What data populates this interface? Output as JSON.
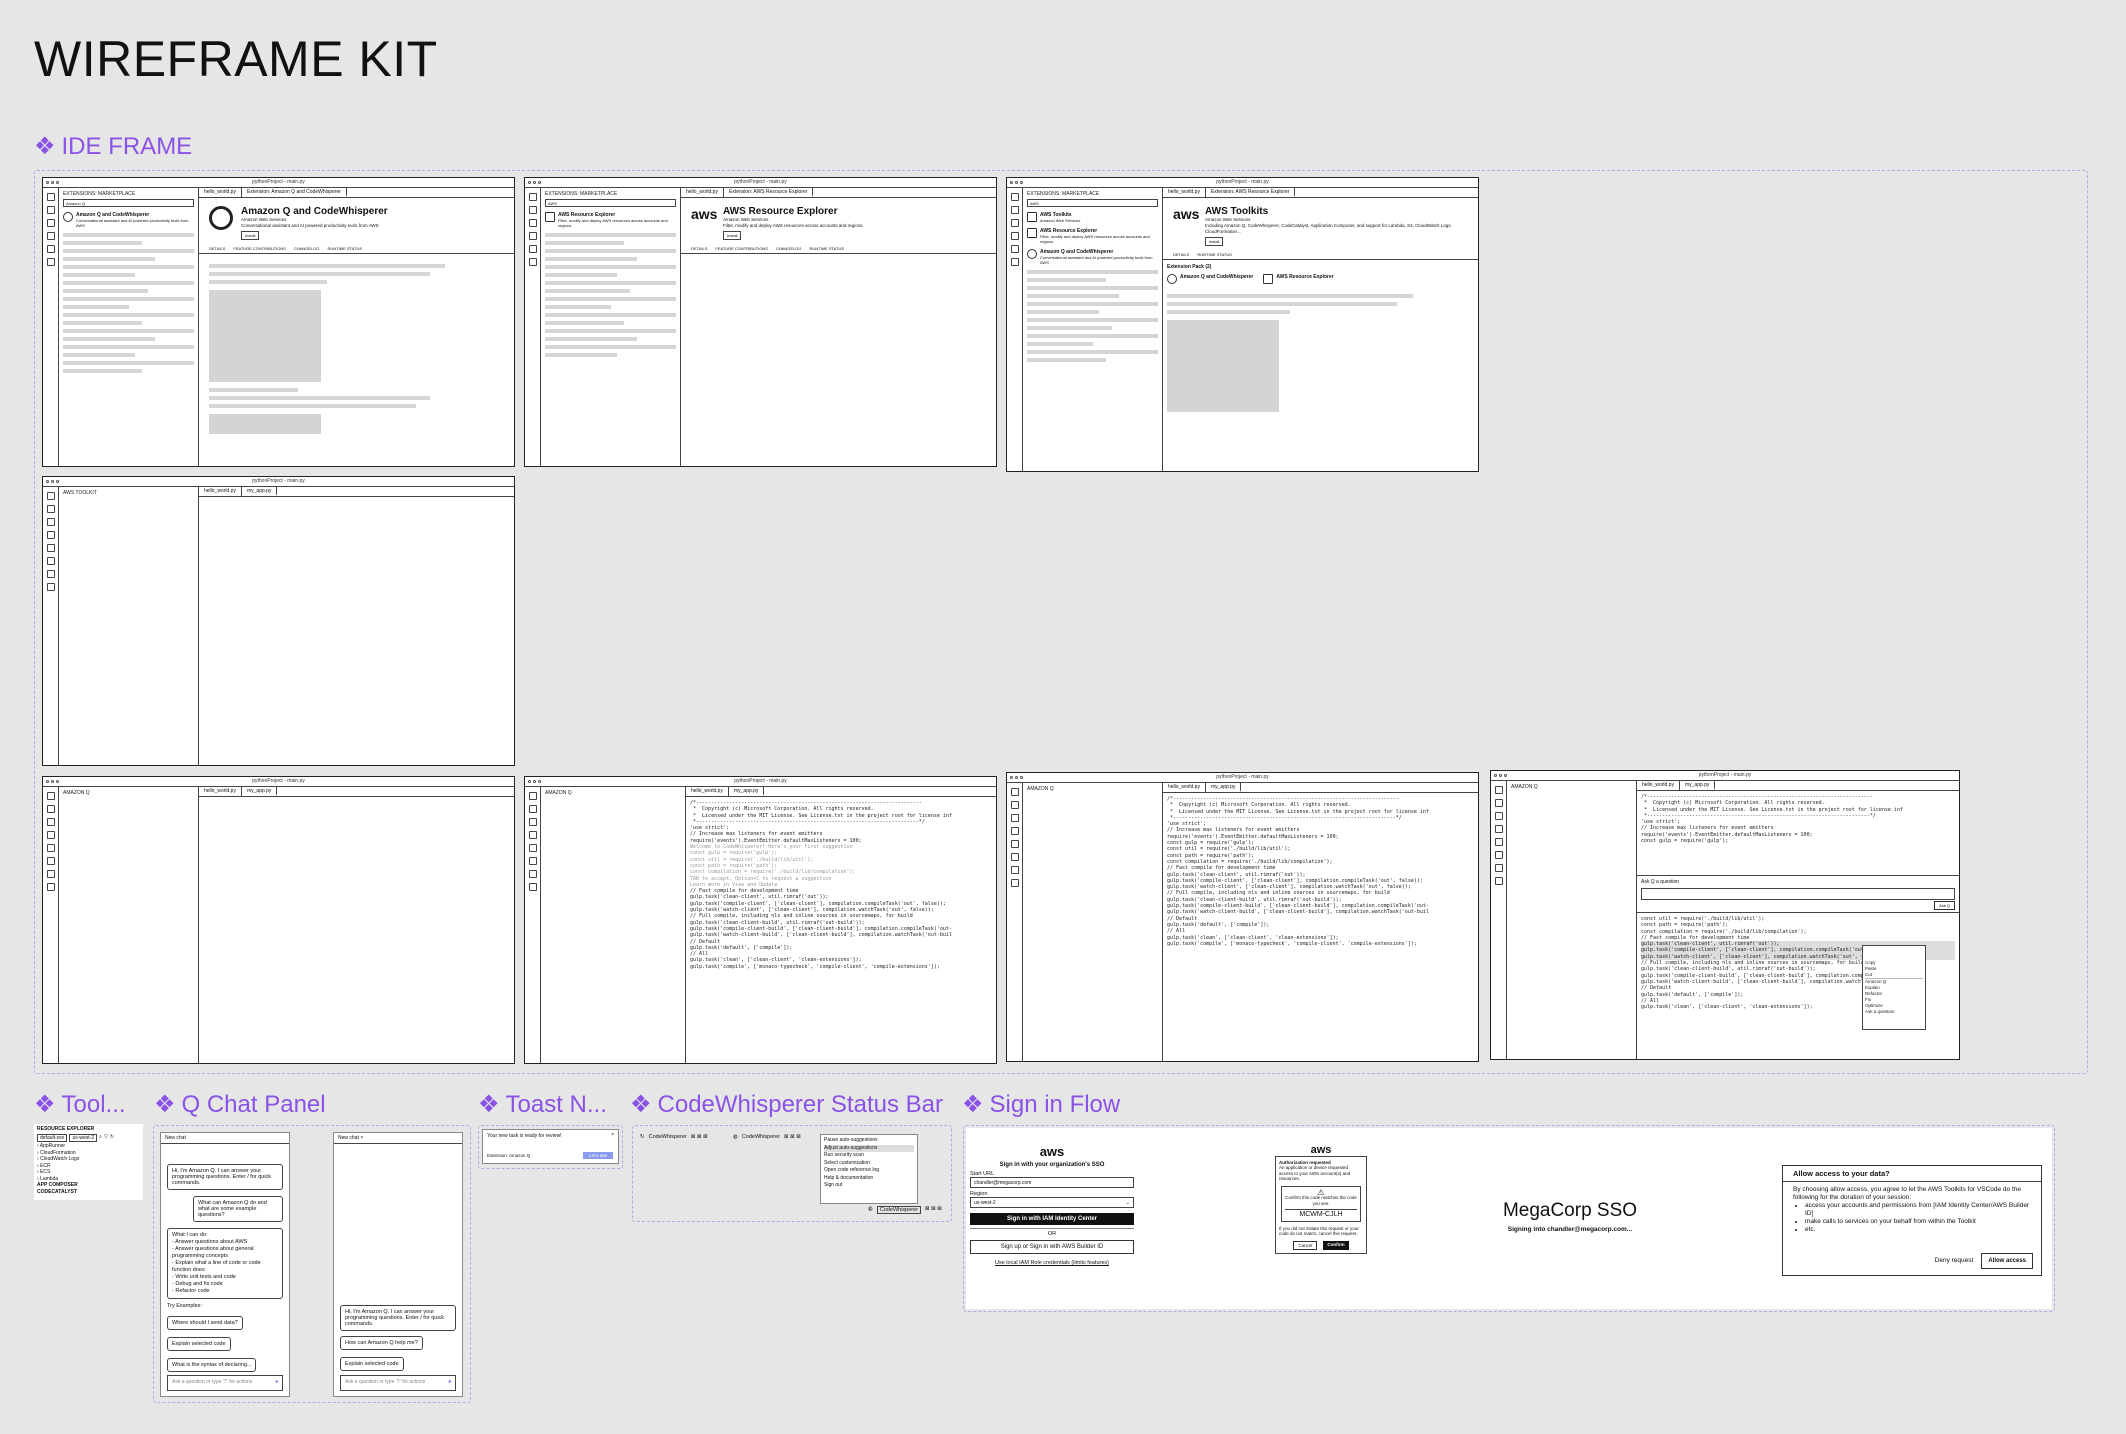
{
  "title": "WIREFRAME KIT",
  "sections": {
    "ide_frame": "IDE FRAME",
    "toolkit": "Tool...",
    "q_chat": "Q Chat Panel",
    "toast": "Toast N...",
    "status_bar": "CodeWhisperer Status Bar",
    "sign_in": "Sign in Flow"
  },
  "ide": {
    "window_title": "pythonProject - main.py",
    "marketplace": "EXTENSIONS: MARKETPLACE",
    "search_value": "Amazon Q",
    "search_aws": "AWS",
    "toolkit_panel": "AWS TOOLKIT",
    "amazon_q_panel": "AMAZON Q",
    "tab_hello": "hello_world.py",
    "tab_file": "my_app.py",
    "ext_tab_q": "Extension: Amazon Q and CodeWhisperer",
    "ext_tab_explorer": "Extension: AWS Resource Explorer",
    "ext_tab_toolkit": "Extension: AWS Resource Explorer",
    "ext1": {
      "name": "Amazon Q and CodeWhisperer",
      "publisher": "Amazon Web Services",
      "desc": "Conversational assistant and AI powered productivity tools from AWS",
      "btn": "Install"
    },
    "ext2": {
      "name": "AWS Resource Explorer",
      "publisher": "Amazon Web Services",
      "desc": "Filter, modify and deploy AWS resources across accounts and regions.",
      "btn": "Install"
    },
    "ext3": {
      "name": "AWS Toolkits",
      "publisher": "Amazon Web Services",
      "desc": "Including Amazon Q, CodeWhisperer, CodeCatalyst, Application Composer, and support for Lambda, S3, CloudWatch Logs, CloudFormation...",
      "btn": "Install"
    },
    "detail_tabs": [
      "DETAILS",
      "FEATURE CONTRIBUTIONS",
      "CHANGELOG",
      "RUNTIME STATUS"
    ],
    "extension_pack": "Extension Pack (2)",
    "code_lines": [
      "/*---------------------------------------------------------------------------",
      " *  Copyright (c) Microsoft Corporation. All rights reserved.",
      " *  Licensed under the MIT License. See License.txt in the project root for license inf",
      " *--------------------------------------------------------------------------*/",
      "",
      "'use strict';",
      "",
      "// Increase max listeners for event emitters",
      "require('events').EventEmitter.defaultMaxListeners = 100;",
      "",
      "const gulp = require('gulp');",
      "const util = require('./build/lib/util');",
      "const path = require('path');",
      "const compilation = require('./build/lib/compilation');",
      "",
      "// Fast compile for development time",
      "gulp.task('clean-client', util.rimraf('out'));",
      "gulp.task('compile-client', ['clean-client'], compilation.compileTask('out', false));",
      "gulp.task('watch-client', ['clean-client'], compilation.watchTask('out', false));",
      "",
      "// Full compile, including nls and inline sources in sourcemaps, for build",
      "gulp.task('clean-client-build', util.rimraf('out-build'));",
      "gulp.task('compile-client-build', ['clean-client-build'], compilation.compileTask('out-",
      "gulp.task('watch-client-build', ['clean-client-build'], compilation.watchTask('out-buil",
      "",
      "// Default",
      "gulp.task('default', ['compile']);",
      "",
      "// All",
      "gulp.task('clean', ['clean-client', 'clean-extensions']);",
      "gulp.task('compile', ['monaco-typecheck', 'compile-client', 'compile-extensions']);"
    ],
    "ghost_lines": [
      "Welcome to CodeWhisperer! Here's your first suggestion",
      "",
      "const gulp = require('gulp');",
      "const util = require('./build/lib/util');",
      "const path = require('path');",
      "const compilation = require('./build/lib/compilation');",
      "",
      "TAB to accept, Option+C to request a suggestion",
      "Learn more in View and Update"
    ],
    "ask_label": "Ask Q a question",
    "ask_btn": "Ask Q",
    "context_menu": [
      "Copy",
      "Paste",
      "Cut",
      "Amazon Q",
      "Explain",
      "Refactor",
      "Fix",
      "Optimize",
      "Ask a question"
    ]
  },
  "toolkit": {
    "root": "RESOURCE EXPLORER",
    "profile": "default-sso",
    "region": "us-west-2",
    "items": [
      "AppRunner",
      "CloudFormation",
      "CloudWatch Logs",
      "ECR",
      "ECS",
      "Lambda"
    ],
    "app_composer": "APP COMPOSER",
    "codecatalyst": "CODECATALYST"
  },
  "q_chat": {
    "tab": "New chat",
    "intro": "Hi, I'm Amazon Q. I can answer your programming questions. Enter / for quick commands.",
    "question": "What can Amazon Q do and what are some example questions?",
    "answer_title": "What I can do:",
    "answer_items": [
      "Answer questions about AWS",
      "Answer questions about general programming concepts",
      "Explain what a line of code or code function does",
      "Write unit tests and code",
      "Debug and fix code",
      "Refactor code"
    ],
    "examples_label": "Try Examples:",
    "examples": [
      "Where should I send data?",
      "Explain selected code",
      "What is the syntax of declaring..."
    ],
    "examples2": [
      "How can Amazon Q help me?",
      "Explain selected code"
    ],
    "input_placeholder": "Ask a question or type \"/\" for actions"
  },
  "toast": {
    "message": "Your new task is ready for review!",
    "source": "Extension: Amazon Q",
    "action": "Let's see"
  },
  "status_bar": {
    "item1": "CodeWhisperer",
    "item2": "CodeWhisperer",
    "menu": [
      "Pause auto-suggestions",
      "Adjust auto-suggestions",
      "Run security scan",
      "Select customization",
      "Open code reference log",
      "Help & documentation",
      "Sign out"
    ],
    "footer": "CodeWhisperer"
  },
  "sign_in": {
    "logo": "aws",
    "heading": "Sign in with your organization's SSO",
    "start_url_label": "Start URL",
    "start_url": "chandler@megacorp.com",
    "region_label": "Region",
    "region": "us-west-2",
    "sign_in_btn": "Sign in with IAM Identity Center",
    "or": "OR",
    "builder_btn": "Sign up or Sign in with AWS Builder ID",
    "iam_link": "Use local IAM Role credentials (limits features)",
    "auth_title": "Authorization requested",
    "auth_desc": "An application or device requested access to your AWS account(s) and resources.",
    "auth_code_label": "Confirm this code matches the code you see.",
    "auth_code": "MCWM-CJLH",
    "auth_note": "If you did not initiate this request or your code do not match, cancel this request.",
    "cancel": "Cancel",
    "confirm": "Confirm",
    "mega_title": "MegaCorp SSO",
    "mega_sub": "Signing into chandler@megacorp.com...",
    "allow_title": "Allow access to your data?",
    "allow_intro": "By choosing allow access, you agree to let the AWS Toolkits for VSCode do the following for the duration of your session:",
    "allow_items": [
      "access your accounts and permissions from [IAM Identity Center/AWS Builder ID]",
      "make calls to services on your behalf from within the Toolkit",
      "etc."
    ],
    "deny": "Deny request",
    "allow": "Allow access"
  }
}
